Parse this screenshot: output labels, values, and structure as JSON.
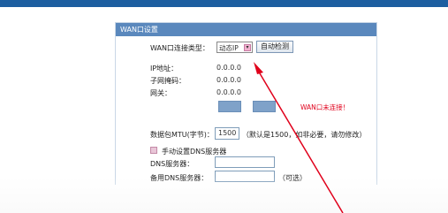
{
  "panel": {
    "title": "WAN口设置",
    "connection_type_label": "WAN口连接类型：",
    "connection_type_value": "动态IP",
    "auto_detect_label": "自动检测",
    "ip_label": "IP地址：",
    "ip_value": "0.0.0.0",
    "subnet_label": "子网掩码：",
    "subnet_value": "0.0.0.0",
    "gateway_label": "网关：",
    "gateway_value": "0.0.0.0",
    "status_text": "WAN口未连接！",
    "mtu_label": "数据包MTU(字节)：",
    "mtu_value": "1500",
    "mtu_note": "（默认是1500，如非必要，请勿修改）",
    "manual_dns_label": "手动设置DNS服务器",
    "dns_label": "DNS服务器：",
    "dns_value": "",
    "alt_dns_label": "备用DNS服务器：",
    "alt_dns_value": "",
    "optional_note": "（可选）"
  },
  "colors": {
    "header_bg": "#5a88bd",
    "top_bar": "#1d5ea0",
    "status_red": "#e0001b",
    "arrow_red": "#e0001b"
  }
}
